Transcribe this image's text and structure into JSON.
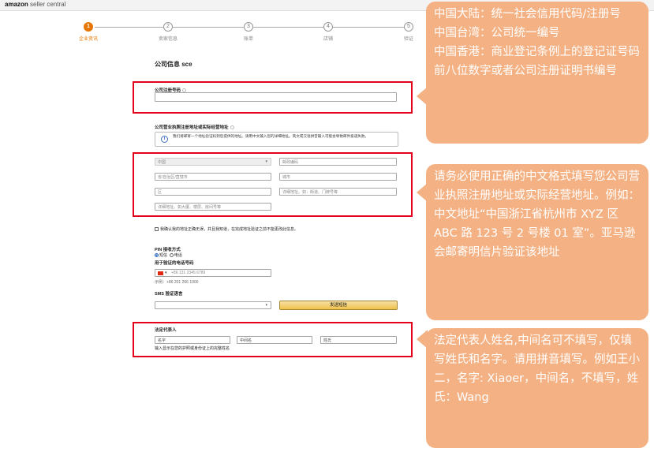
{
  "header": {
    "logo_brand": "amazon",
    "logo_suffix": " seller central"
  },
  "stepper": {
    "steps": [
      {
        "num": "1",
        "label": "企业资讯",
        "active": true
      },
      {
        "num": "2",
        "label": "卖家信息",
        "active": false
      },
      {
        "num": "3",
        "label": "账单",
        "active": false
      },
      {
        "num": "4",
        "label": "店铺",
        "active": false
      },
      {
        "num": "5",
        "label": "验证",
        "active": false
      }
    ]
  },
  "form": {
    "title": "公司信息 sce",
    "reg_number": {
      "label": "公司注册号码",
      "value": ""
    },
    "address": {
      "label": "公司营业执照注册地址或实际经营地址",
      "notice": "我们将邮寄一个地址验证码到您提供的地址。请用中文输入您的详细地址。英文或汉语拼音输入可能会导致邮件投递失败。",
      "country": "中国",
      "postal_placeholder": "邮政编码",
      "province_placeholder": "省/自治区/直辖市",
      "city_placeholder": "城市",
      "district_placeholder": "区",
      "street_placeholder": "详细地址。如：街道、门牌号等",
      "detail_placeholder": "详细地址。如大厦、楼层、房间号等"
    },
    "confirm_checkbox": "我确认我的地址正确无误，并且我知道，在完成地址验证之前不能更改此信息。",
    "pin": {
      "label": "PIN 接收方式",
      "option_sms": "短信",
      "option_call": "电话",
      "phone_label": "用于验证的电话号码",
      "phone_placeholder": "+86 131 2345 6789",
      "phone_example": "示例：+86 201 266 1000"
    },
    "sms_language": {
      "label": "SMS 验证语言",
      "send_button": "发送短信"
    },
    "legal_rep": {
      "label": "法定代表人",
      "first_placeholder": "名字",
      "middle_placeholder": "中间名",
      "last_placeholder": "姓氏",
      "hint": "输入显示在您的护照或身份证上的完整姓名"
    }
  },
  "callouts": {
    "reg_number": "中国大陆：统一社会信用代码/注册号\n中国台湾：公司统一编号\n中国香港：商业登记条例上的登记证号码前八位数字或者公司注册证明书编号",
    "address": "请务必使用正确的中文格式填写您公司营业执照注册地址或实际经营地址。例如：中文地址“中国浙江省杭州市 XYZ 区 ABC 路 123 号 2 号楼 01 室”。亚马逊会邮寄明信片验证该地址",
    "legal_rep": "法定代表人姓名,中间名可不填写，仅填写姓氏和名字。请用拼音填写。例如王小二，名字: Xiaoer，中间名，不填写，姓氏：Wang"
  },
  "colors": {
    "accent": "#e77600",
    "highlight": "#e3001b",
    "callout_bg": "#f4b183"
  }
}
